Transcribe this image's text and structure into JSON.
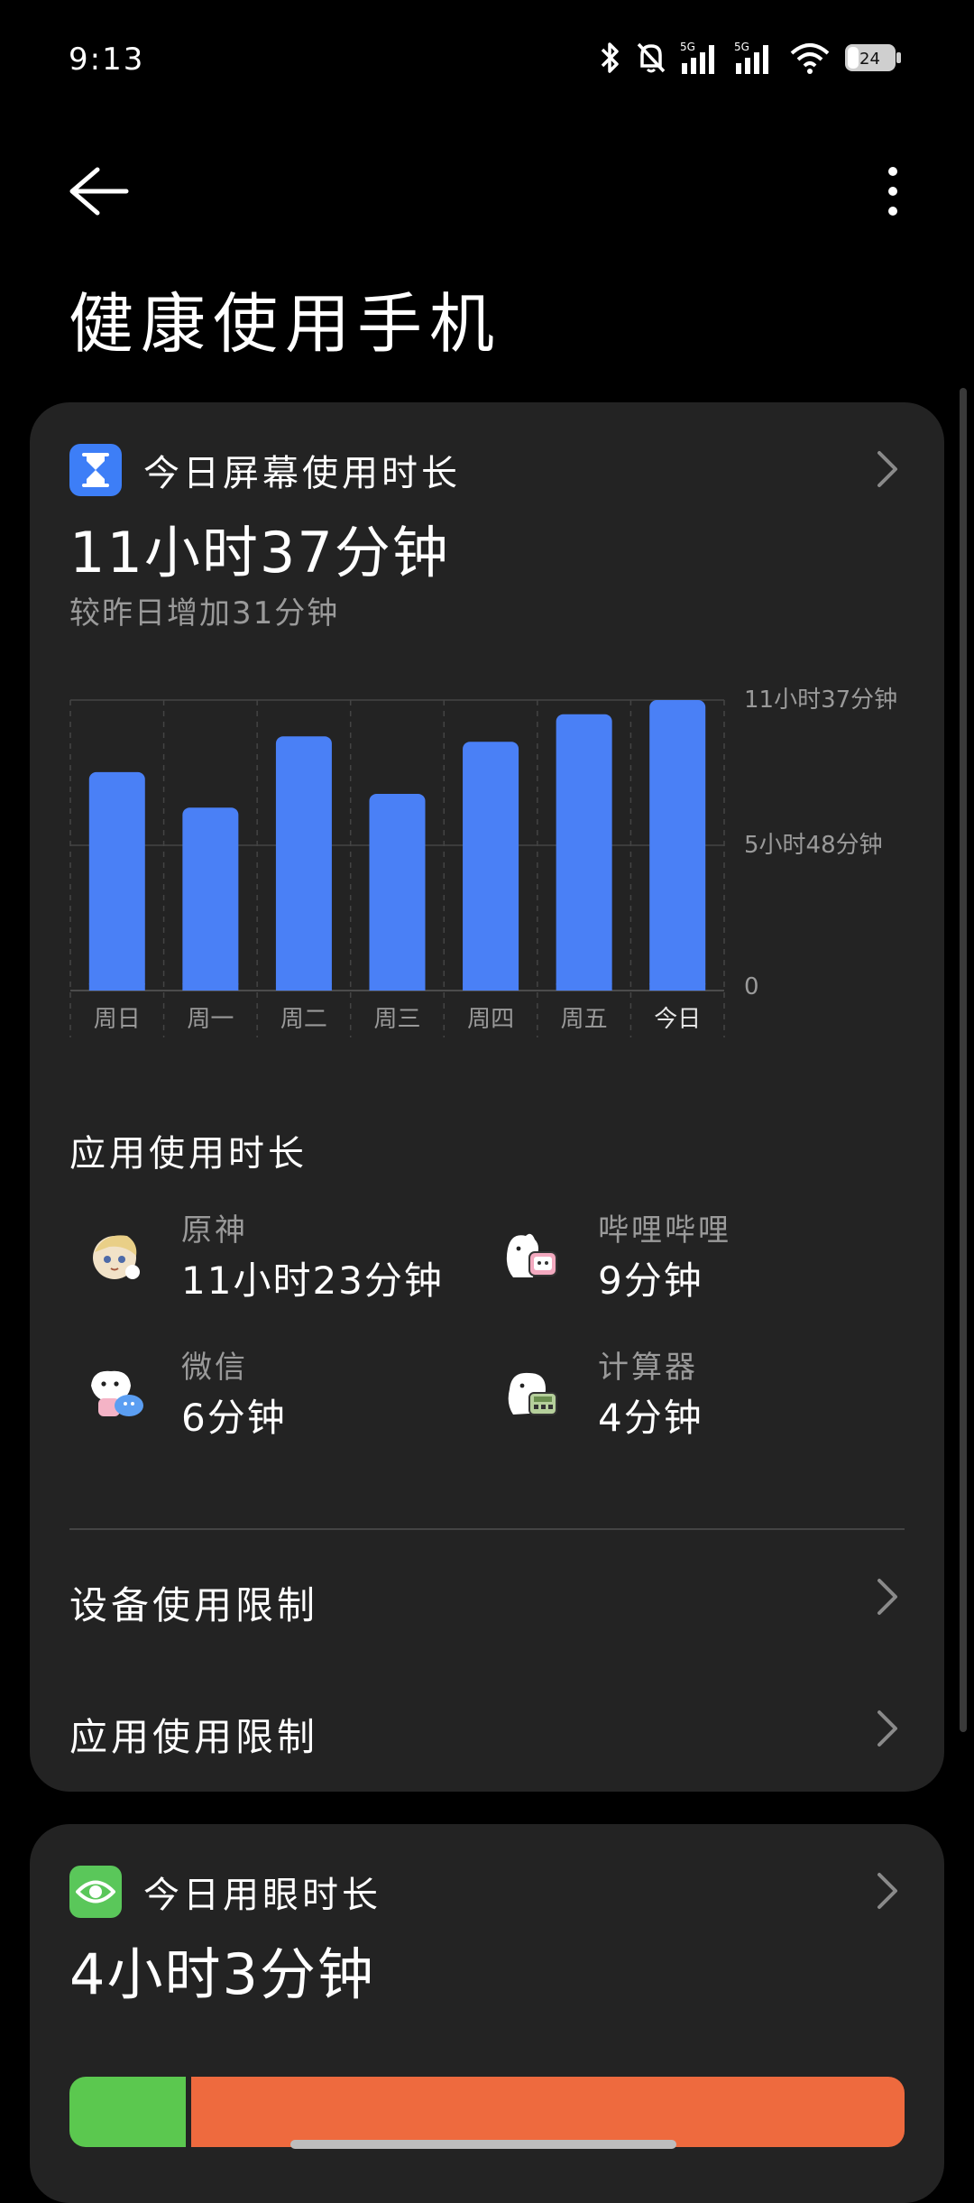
{
  "status": {
    "time": "9:13",
    "battery": "24",
    "signal_label": "5G"
  },
  "header": {
    "title": "健康使用手机",
    "back_icon": "arrow-left-icon",
    "more_icon": "more-vertical-icon"
  },
  "screen_time": {
    "title": "今日屏幕使用时长",
    "value": "11小时37分钟",
    "compare": "较昨日增加31分钟",
    "badge_color": "#3D7EF7"
  },
  "chart_data": {
    "type": "bar",
    "categories": [
      "周日",
      "周一",
      "周二",
      "周三",
      "周四",
      "周五",
      "今日"
    ],
    "values_minutes": [
      524,
      439,
      610,
      472,
      597,
      663,
      697
    ],
    "y_ticks": [
      "11小时37分钟",
      "5小时48分钟",
      "0"
    ],
    "ylim_minutes": [
      0,
      697
    ],
    "bar_color": "#4A80F6",
    "grid": true
  },
  "app_usage": {
    "title": "应用使用时长",
    "apps": [
      {
        "name": "原神",
        "time": "11小时23分钟",
        "icon": "genshin-icon"
      },
      {
        "name": "哔哩哔哩",
        "time": "9分钟",
        "icon": "bilibili-icon"
      },
      {
        "name": "微信",
        "time": "6分钟",
        "icon": "wechat-icon"
      },
      {
        "name": "计算器",
        "time": "4分钟",
        "icon": "calculator-icon"
      }
    ]
  },
  "limits": {
    "device": "设备使用限制",
    "app": "应用使用限制"
  },
  "eye_time": {
    "title": "今日用眼时长",
    "value": "4小时3分钟",
    "badge_color": "#5AC75A",
    "segments": [
      {
        "color": "#5BC84F",
        "fraction": 0.14
      },
      {
        "color": "#EE6A3E",
        "fraction": 0.86
      }
    ]
  }
}
